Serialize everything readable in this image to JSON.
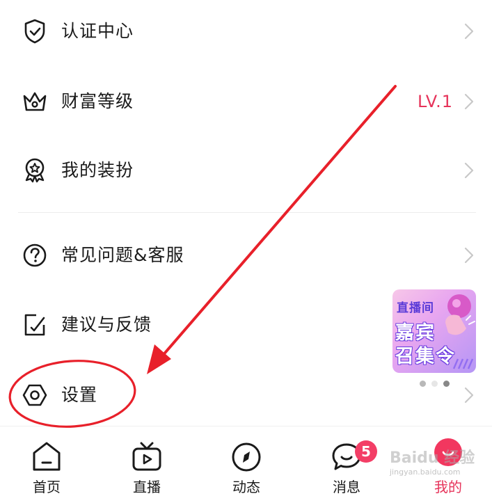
{
  "menu": {
    "items": [
      {
        "label": "认证中心",
        "icon": "shield-icon"
      },
      {
        "label": "财富等级",
        "icon": "crown-icon",
        "value": "LV.1"
      },
      {
        "label": "我的装扮",
        "icon": "award-badge-icon"
      },
      {
        "label": "常见问题&客服",
        "icon": "question-icon"
      },
      {
        "label": "建议与反馈",
        "icon": "feedback-edit-icon"
      },
      {
        "label": "设置",
        "icon": "settings-hexagon-icon"
      }
    ]
  },
  "banner": {
    "tag": "直播间",
    "line1": "嘉宾",
    "line2": "召集令",
    "page_count": 3,
    "active_page": 3
  },
  "bottom_nav": {
    "items": [
      {
        "label": "首页",
        "icon": "home-icon"
      },
      {
        "label": "直播",
        "icon": "tv-play-icon"
      },
      {
        "label": "动态",
        "icon": "compass-icon"
      },
      {
        "label": "消息",
        "icon": "chat-bubble-icon",
        "badge": "5"
      },
      {
        "label": "我的",
        "icon": "profile-face-icon"
      }
    ]
  },
  "watermark": {
    "line1": "Baidu 经验",
    "line2": "jingyan.baidu.com"
  },
  "colors": {
    "accent": "#e6335a",
    "badge": "#f33e66",
    "annotation": "#e8202a"
  }
}
